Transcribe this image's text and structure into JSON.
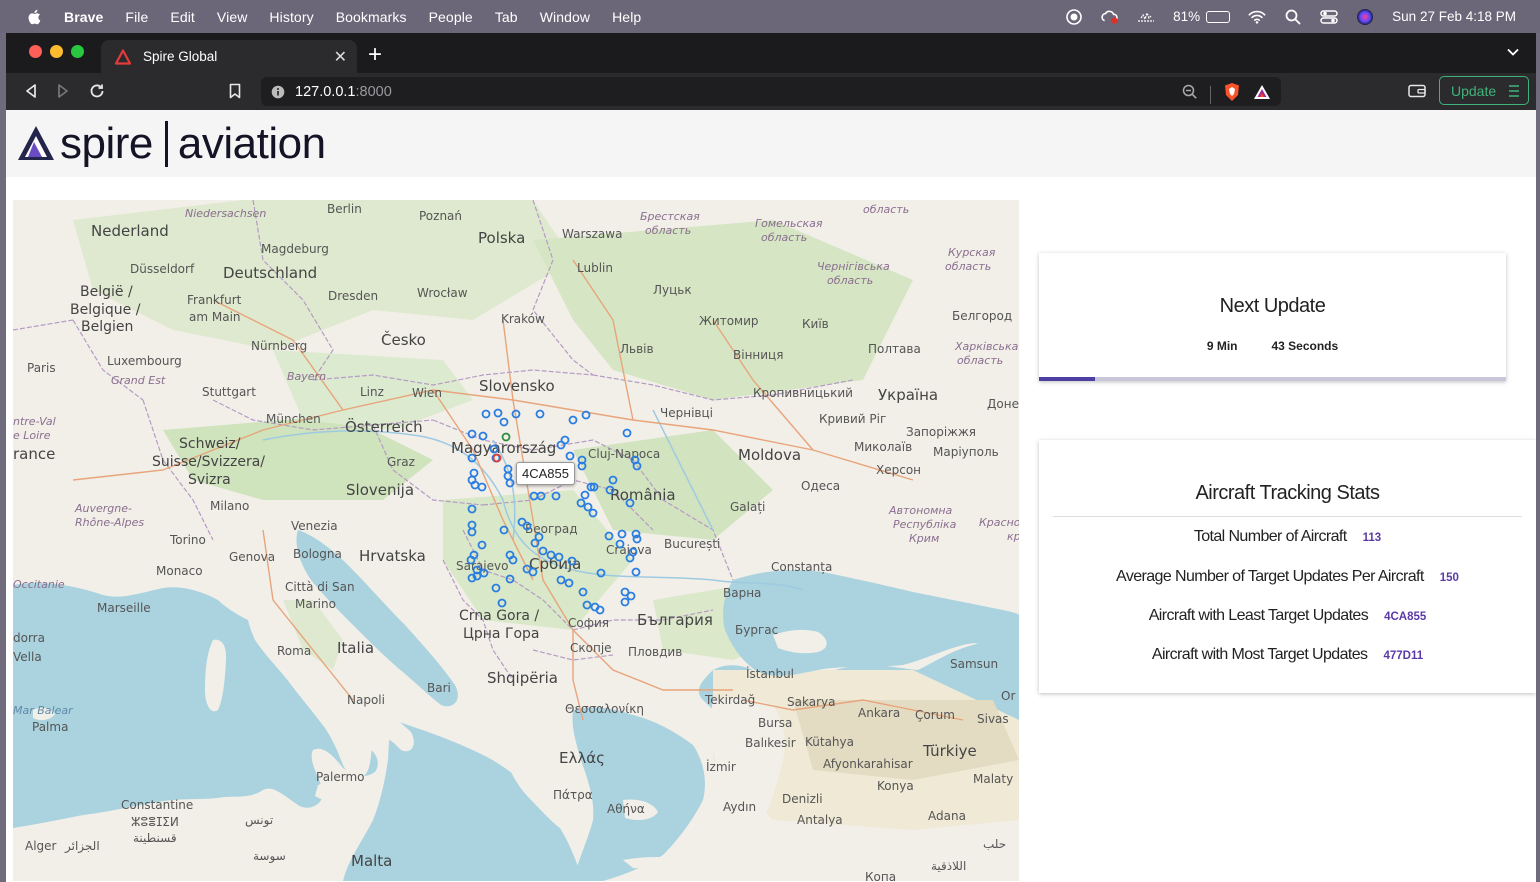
{
  "menubar": {
    "items": [
      "Brave",
      "File",
      "Edit",
      "View",
      "History",
      "Bookmarks",
      "People",
      "Tab",
      "Window",
      "Help"
    ],
    "battery": "81%",
    "battery_level": 0.81,
    "clock": "Sun 27 Feb 4:18 PM"
  },
  "browser": {
    "tab_title": "Spire Global",
    "url_host": "127.0.0.1",
    "url_port": ":8000",
    "update_label": "Update"
  },
  "page": {
    "logo_left": "spire",
    "logo_right": "aviation",
    "next_update": {
      "title": "Next Update",
      "minutes": "9 Min",
      "seconds": "43 Seconds",
      "progress": 0.12
    },
    "stats": {
      "title": "Aircraft Tracking Stats",
      "rows": [
        {
          "label": "Total Number of Aircraft",
          "value": "113"
        },
        {
          "label": "Average Number of Target Updates Per Aircraft",
          "value": "150"
        },
        {
          "label": "Aircraft with Least Target Updates",
          "value": "4CA855"
        },
        {
          "label": "Aircraft with Most Target Updates",
          "value": "477D11"
        }
      ]
    },
    "map": {
      "tooltip": "4CA855",
      "labels": {
        "niedersachsen": "Niedersachsen",
        "berlin": "Berlin",
        "poznan": "Poznań",
        "brest": "Брестская",
        "oblast": "область",
        "gomel": "Гомельская",
        "oblast2": "область",
        "oblast3": "область",
        "nederland": "Nederland",
        "magdeburg": "Magdeburg",
        "polska": "Polska",
        "warszawa": "Warszawa",
        "kursk": "Курская",
        "oblast4": "область",
        "dusseldorf": "Düsseldorf",
        "deutschland": "Deutschland",
        "lublin": "Lublin",
        "chernihiv": "Чернігівська",
        "oblast5": "область",
        "belgie": "België /",
        "belgique": "Belgique /",
        "belgien": "Belgien",
        "frankfurt": "Frankfurt",
        "ammain": "am Main",
        "dresden": "Dresden",
        "wroclaw": "Wrocław",
        "lutsk": "Луцьк",
        "krakow": "Kraków",
        "zhytomyr": "Житомир",
        "kyiv": "Київ",
        "belgorod": "Белгород",
        "luxembourg": "Luxembourg",
        "nurnberg": "Nürnberg",
        "cesko": "Česko",
        "lviv": "Львів",
        "vinnytsia": "Вінниця",
        "poltava": "Полтава",
        "kharkiv": "Харківська",
        "oblast6": "область",
        "paris": "Paris",
        "grandest": "Grand Est",
        "bayern": "Bayern",
        "stuttgart": "Stuttgart",
        "linz": "Linz",
        "wien": "Wien",
        "slovensko": "Slovensko",
        "kropyvnytskyi": "Кропивницький",
        "ukraina": "Україна",
        "donetsk": "Доне",
        "munchen": "München",
        "osterreich": "Österreich",
        "chernivtsi": "Чернівці",
        "kryvyirih": "Кривий Ріг",
        "zaporizhzhia": "Запоріжжя",
        "centreval": "ntre-Val",
        "deloire": "e Loire",
        "france": "rance",
        "schweiz": "Schweiz/",
        "suisse": "Suisse/Svizzera/",
        "svizra": "Svizra",
        "graz": "Graz",
        "magyarorszag": "Magyarország",
        "clujnapoca": "Cluj-Napoca",
        "mykolaiv": "Миколаїв",
        "mariupol": "Маріуполь",
        "moldova": "Moldova",
        "kherson": "Херсон",
        "slovenija": "Slovenija",
        "odesa": "Одеса",
        "romania": "România",
        "auvergne": "Auvergne-",
        "rhonealpes": "Rhône-Alpes",
        "milano": "Milano",
        "venezia": "Venezia",
        "galati": "Galați",
        "autonomna": "Автономна",
        "respublika": "Республіка",
        "krym": "Крим",
        "krasno": "Красно",
        "kr": "кр",
        "torino": "Torino",
        "beograd": "Београд",
        "bucuresti": "București",
        "genova": "Genova",
        "bologna": "Bologna",
        "hrvatska": "Hrvatska",
        "craiova": "Craiova",
        "monaco": "Monaco",
        "sarajevo": "Sarajevo",
        "srbija": "Србија",
        "constanta": "Constanța",
        "occitanie": "Occitanie",
        "cittadisan": "Città di San",
        "marino": "Marino",
        "varna": "Варна",
        "marseille": "Marseille",
        "crnagora": "Crna Gora /",
        "crnagora2": "Црна Гора",
        "sofia": "София",
        "bulgaria": "България",
        "burgas": "Бургас",
        "andorra": "dorra",
        "vella": "Vella",
        "roma": "Roma",
        "italia": "Italia",
        "skopje": "Скопје",
        "plovdiv": "Пловдив",
        "samsun": "Samsun",
        "shqiperia": "Shqipëria",
        "istanbul": "İstanbul",
        "bari": "Bari",
        "tekirdag": "Tekirdağ",
        "sakarya": "Sakarya",
        "or": "Or",
        "napoli": "Napoli",
        "thessaloniki": "Θεσσαλονίκη",
        "ankara": "Ankara",
        "corum": "Çorum",
        "sivas": "Sivas",
        "marbalear": "Mar Balear",
        "palma": "Palma",
        "bursa": "Bursa",
        "balikesir": "Balıkesir",
        "kutahya": "Kütahya",
        "turkiye": "Türkiye",
        "ellas": "Ελλάς",
        "izmir": "İzmir",
        "afyonkarahisar": "Afyonkarahisar",
        "malatya": "Malaty",
        "palermo": "Palermo",
        "konya": "Konya",
        "patra": "Πάτρα",
        "athina": "Αθήνα",
        "aydin": "Aydın",
        "denizli": "Denizli",
        "constantine": "Constantine",
        "constantine_amazigh": "ⵣⵓⴻⵊⵉⵍ",
        "qusantina": "قسنطينة",
        "tunis": "تونس",
        "antalya": "Antalya",
        "adana": "Adana",
        "alger": "Alger",
        "aljazair": "الجزائر",
        "sousse": "سوسة",
        "malta": "Malta",
        "halab": "حلب",
        "allathiqiya": "اللاذقية",
        "konva": "Копа"
      }
    }
  }
}
